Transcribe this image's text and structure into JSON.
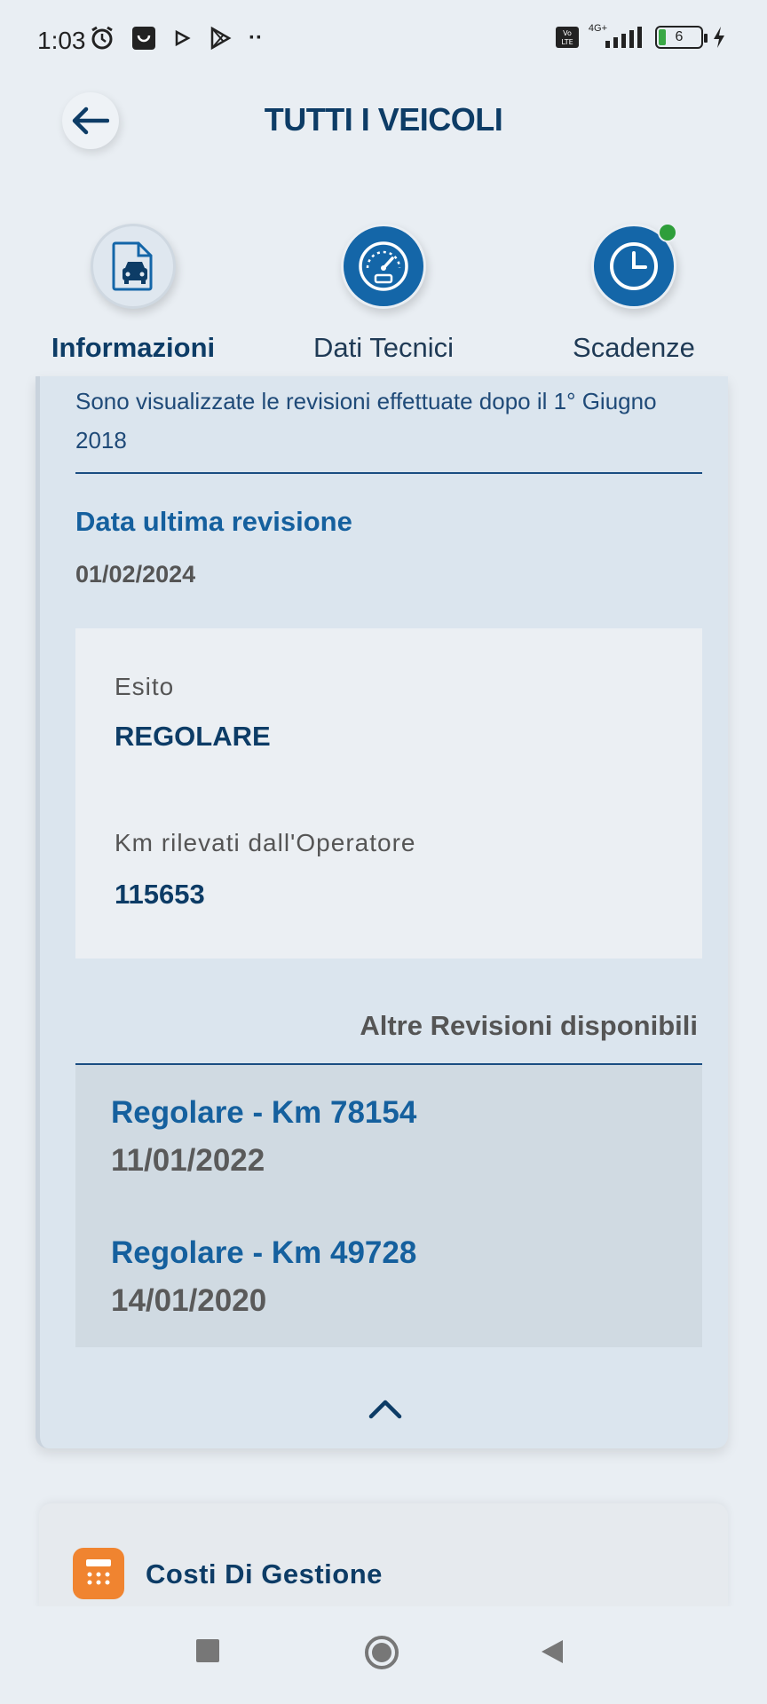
{
  "status_bar": {
    "time": "1:03",
    "network": "4G+",
    "battery": "6"
  },
  "header": {
    "title": "TUTTI I VEICOLI"
  },
  "tabs": [
    {
      "label": "Informazioni",
      "icon": "car-document-icon",
      "active": true
    },
    {
      "label": "Dati Tecnici",
      "icon": "speedometer-icon",
      "active": false
    },
    {
      "label": "Scadenze",
      "icon": "clock-icon",
      "active": false,
      "notification": true
    }
  ],
  "revision": {
    "intro": "Sono visualizzate le revisioni effettuate dopo il 1° Giugno 2018",
    "last_label": "Data ultima revisione",
    "last_date": "01/02/2024",
    "esito_label": "Esito",
    "esito_value": "REGOLARE",
    "km_label": "Km rilevati dall'Operatore",
    "km_value": "115653",
    "other_title": "Altre Revisioni disponibili",
    "others": [
      {
        "title": "Regolare - Km 78154",
        "date": "11/01/2022"
      },
      {
        "title": "Regolare - Km 49728",
        "date": "14/01/2020"
      }
    ]
  },
  "costs_section": {
    "label": "Costi Di Gestione",
    "icon": "calculator-icon"
  },
  "colors": {
    "primary": "#0d3c66",
    "accent": "#15609e",
    "orange": "#f08430",
    "green": "#2e9e3a"
  }
}
